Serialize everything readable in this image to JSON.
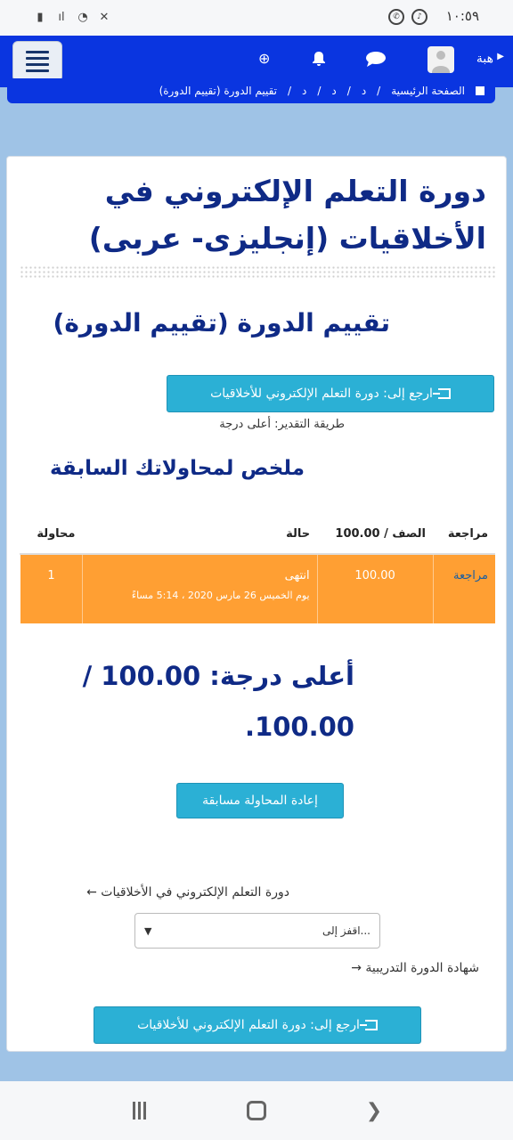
{
  "statusbar": {
    "time": "١٠:٥٩"
  },
  "nav": {
    "user_name": "هبة"
  },
  "breadcrumb": [
    "الصفحة الرئيسية",
    "د",
    "د",
    "د",
    "تقييم الدورة (تقييم الدورة)"
  ],
  "course": {
    "title": "دورة التعلم الإلكتروني في الأخلاقيات (إنجليزى- عربى)"
  },
  "quiz": {
    "title": "تقييم الدورة (تقييم الدورة)",
    "back_button": "ارجع إلى: دورة التعلم الإلكتروني للأخلاقيات",
    "grading_method": "طريقة التقدير: أعلى درجة",
    "summary_heading": "ملخص لمحاولاتك السابقة"
  },
  "table": {
    "headers": {
      "attempt": "محاولة",
      "state": "حالة",
      "grade": "الصف / 100.00",
      "review": "مراجعة"
    },
    "rows": [
      {
        "attempt": "1",
        "state": "انتهى",
        "date": "يوم الخميس 26 مارس 2020 ، 5:14 مساءً",
        "grade": "100.00",
        "review": "مراجعة"
      }
    ]
  },
  "highest_grade": "أعلى درجة: 100.00 / 100.00.",
  "retake_button": "إعادة المحاولة مسابقة",
  "prev_activity": "دورة التعلم الإلكتروني في الأخلاقيات ←",
  "jump_to": "...اقفز إلى",
  "next_activity": "شهادة الدورة التدريبية →",
  "bottom_back_button": "ارجع إلى: دورة التعلم الإلكتروني للأخلاقيات"
}
